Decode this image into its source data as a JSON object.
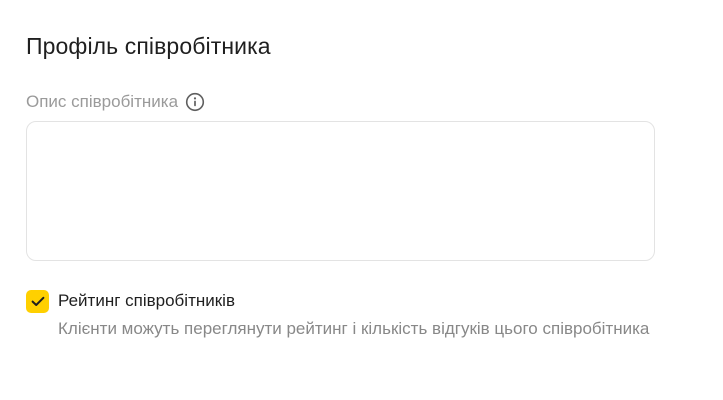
{
  "profile": {
    "title": "Профіль співробітника"
  },
  "description_field": {
    "label": "Опис співробітника",
    "value": "",
    "placeholder": "",
    "info_icon": "info-icon"
  },
  "rating_option": {
    "checked": true,
    "label": "Рейтинг співробітників",
    "description": "Клієнти можуть переглянути рейтинг і кількість відгуків цього співробітника",
    "check_icon": "checkmark-icon"
  },
  "colors": {
    "accent": "#ffd000",
    "text_primary": "#1f1f1f",
    "text_secondary": "#888888",
    "border": "#e3e3e3"
  }
}
